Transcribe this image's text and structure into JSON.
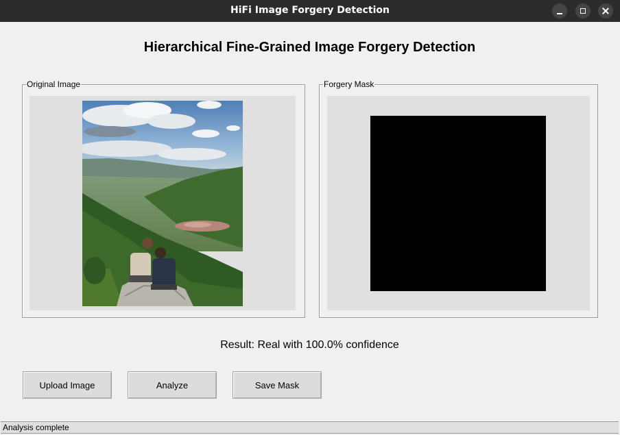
{
  "window": {
    "title": "HiFi Image Forgery Detection",
    "controls": [
      "minimize-icon",
      "maximize-icon",
      "close-icon"
    ]
  },
  "main": {
    "heading": "Hierarchical Fine-Grained Image Forgery Detection",
    "original_panel": {
      "label": "Original Image",
      "image": "photo of two people sitting on a rock overlooking a green mountain valley with a town"
    },
    "mask_panel": {
      "label": "Forgery Mask",
      "mask_color": "#000000"
    },
    "result_text": "Result: Real with 100.0% confidence"
  },
  "buttons": {
    "upload": "Upload Image",
    "analyze": "Analyze",
    "save_mask": "Save Mask"
  },
  "status": {
    "text": "Analysis complete"
  },
  "colors": {
    "titlebar": "#2c2c2c",
    "background": "#f0f0f0",
    "canvas": "#e0e0e0",
    "button": "#dcdcdc"
  }
}
